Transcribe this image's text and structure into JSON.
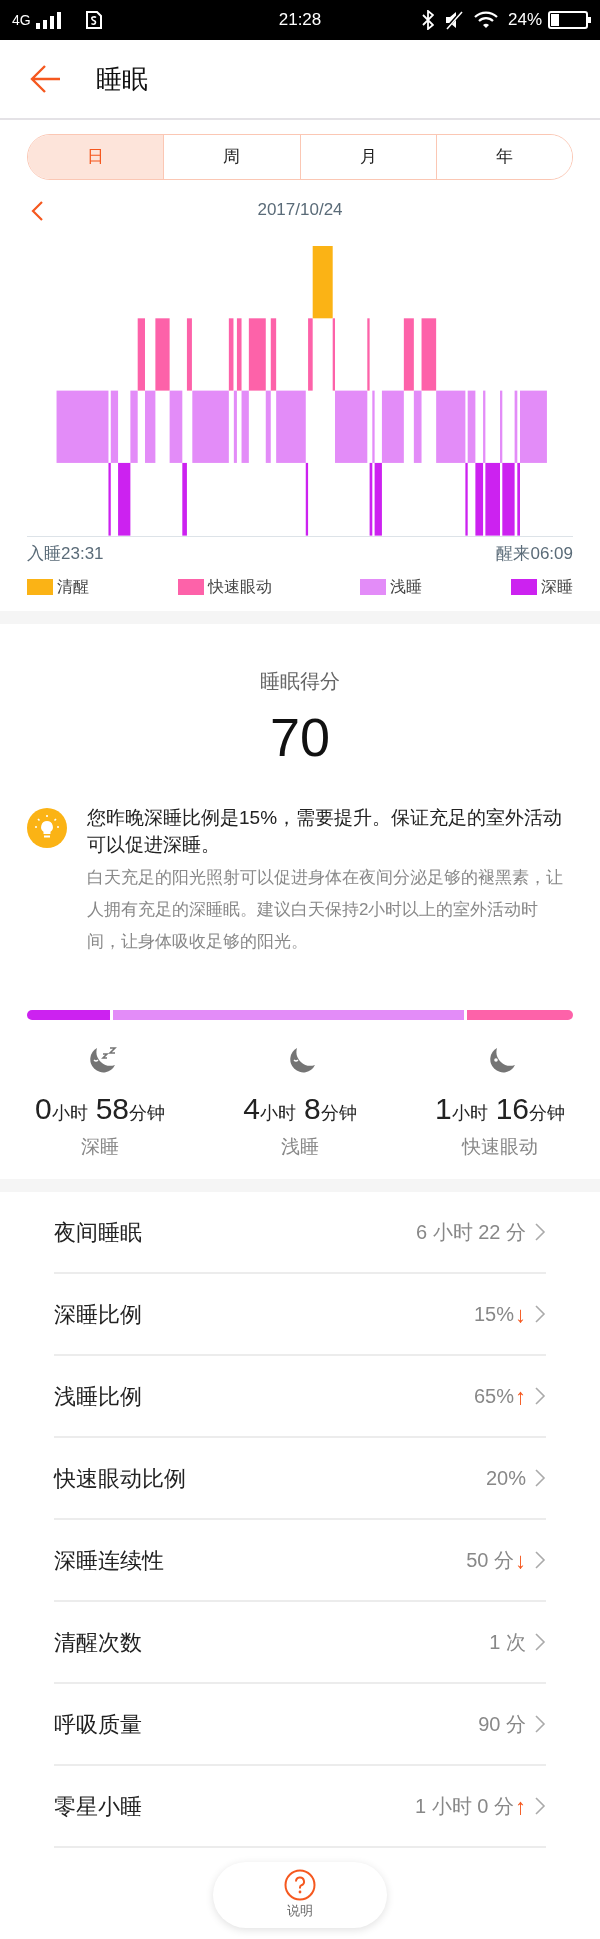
{
  "status_bar": {
    "network": "4G",
    "time": "21:28",
    "battery": "24%"
  },
  "header": {
    "title": "睡眠"
  },
  "tabs": [
    {
      "label": "日",
      "selected": true
    },
    {
      "label": "周",
      "selected": false
    },
    {
      "label": "月",
      "selected": false
    },
    {
      "label": "年",
      "selected": false
    }
  ],
  "date": "2017/10/24",
  "sleep_chart": {
    "start": "入睡23:31",
    "end": "醒来06:09",
    "legend": [
      {
        "label": "清醒",
        "color": "#fbb315"
      },
      {
        "label": "快速眼动",
        "color": "#fd62a9"
      },
      {
        "label": "浅睡",
        "color": "#e38cf8"
      },
      {
        "label": "深睡",
        "color": "#cc22f0"
      }
    ]
  },
  "score": {
    "title": "睡眠得分",
    "value": "70"
  },
  "tip": {
    "headline": "您昨晚深睡比例是15%，需要提升。保证充足的室外活动可以促进深睡。",
    "body": "白天充足的阳光照射可以促进身体在夜间分泌足够的褪黑素，让人拥有充足的深睡眠。建议白天保持2小时以上的室外活动时间，让身体吸收足够的阳光。"
  },
  "durations": [
    {
      "kind": "deep",
      "hours": "0",
      "hours_unit": "小时",
      "minutes": "58",
      "minutes_unit": "分钟",
      "label": "深睡",
      "color": "#cc22f0"
    },
    {
      "kind": "light",
      "hours": "4",
      "hours_unit": "小时",
      "minutes": "8",
      "minutes_unit": "分钟",
      "label": "浅睡",
      "color": "#e38cf8"
    },
    {
      "kind": "rem",
      "hours": "1",
      "hours_unit": "小时",
      "minutes": "16",
      "minutes_unit": "分钟",
      "label": "快速眼动",
      "color": "#fd62a9"
    }
  ],
  "metrics": [
    {
      "label": "夜间睡眠",
      "value": "6 小时 22 分"
    },
    {
      "label": "深睡比例",
      "value": "15%",
      "trend": "↓"
    },
    {
      "label": "浅睡比例",
      "value": "65%",
      "trend": "↑"
    },
    {
      "label": "快速眼动比例",
      "value": "20%"
    },
    {
      "label": "深睡连续性",
      "value": "50 分",
      "trend": "↓"
    },
    {
      "label": "清醒次数",
      "value": "1 次"
    },
    {
      "label": "呼吸质量",
      "value": "90 分"
    },
    {
      "label": "零星小睡",
      "value": "1 小时 0 分",
      "trend": "↑"
    }
  ],
  "help_button": {
    "label": "说明"
  }
}
